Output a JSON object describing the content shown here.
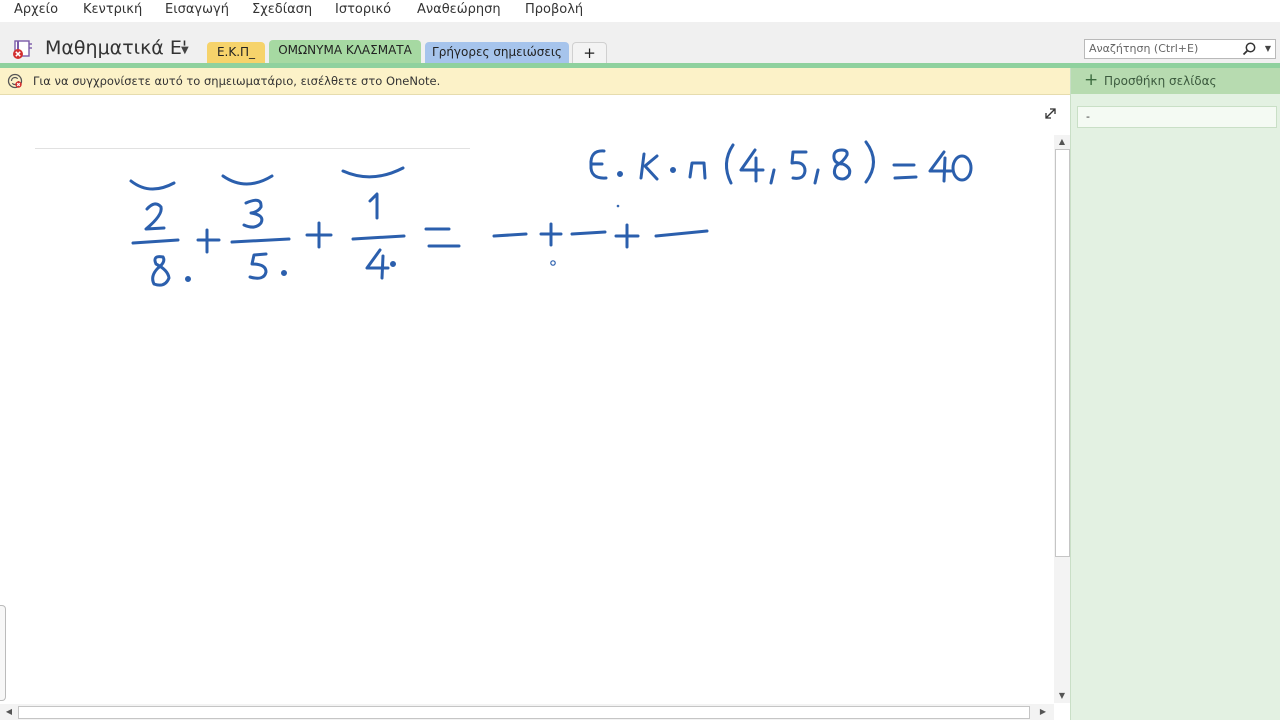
{
  "menu": [
    "Αρχείο",
    "Κεντρική",
    "Εισαγωγή",
    "Σχεδίαση",
    "Ιστορικό",
    "Αναθεώρηση",
    "Προβολή"
  ],
  "notebook": {
    "title": "Μαθηματικά Ε'"
  },
  "tabs": [
    {
      "label": "Ε.Κ.Π_",
      "color": "#f6d36b"
    },
    {
      "label": "ΟΜΩΝΥΜΑ ΚΛΑΣΜΑΤΑ",
      "color": "#a6d9a2"
    },
    {
      "label": "Γρήγορες σημειώσεις",
      "color": "#a6c4ec"
    },
    {
      "label": "+",
      "color": "#f3f3f3"
    }
  ],
  "search": {
    "placeholder": "Αναζήτηση (Ctrl+E)"
  },
  "info_bar": {
    "text": "Για να συγχρονίσετε αυτό το σημειωματάριο, εισέλθετε στο OneNote."
  },
  "right_panel": {
    "add_page": "Προσθήκη σελίδας",
    "pages": [
      "-"
    ]
  },
  "ink": {
    "line1": "Ε.Κ.Π (4,5,8) = 40",
    "line2": "2/8 + 3/5 + 1/4 = — + — + —"
  },
  "colors": {
    "accent": "#8fd19e",
    "ink": "#2b5fad",
    "info_bar": "#fcf2c8"
  }
}
